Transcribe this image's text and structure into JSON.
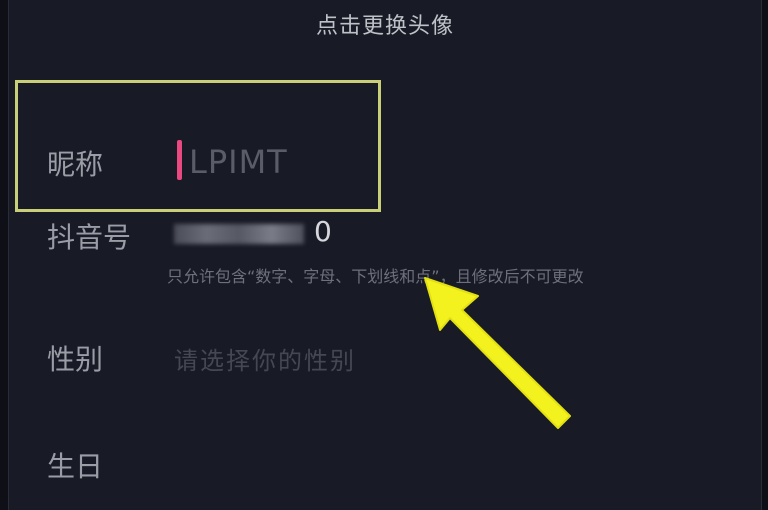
{
  "header": {
    "avatar_hint": "点击更换头像"
  },
  "profile": {
    "nickname": {
      "label": "昵称",
      "value": "LPIMT"
    },
    "douyin_id": {
      "label": "抖音号",
      "visible_tail": "0",
      "hint": "只允许包含“数字、字母、下划线和点”，且修改后不可更改"
    },
    "gender": {
      "label": "性别",
      "placeholder": "请选择你的性别"
    },
    "birthday": {
      "label": "生日"
    }
  },
  "colors": {
    "background": "#181a25",
    "highlight_box": "#c9cf78",
    "cursor": "#e8497f",
    "annotation_arrow": "#f3f21e"
  }
}
